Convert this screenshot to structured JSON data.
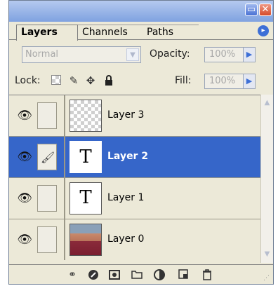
{
  "tabs": [
    {
      "label": "Layers",
      "active": true
    },
    {
      "label": "Channels",
      "active": false
    },
    {
      "label": "Paths",
      "active": false
    }
  ],
  "blend_mode": {
    "value": "Normal"
  },
  "opacity": {
    "label": "Opacity:",
    "value": "100%"
  },
  "lock": {
    "label": "Lock:"
  },
  "fill": {
    "label": "Fill:",
    "value": "100%"
  },
  "layers": [
    {
      "name": "Layer 3",
      "thumb": "transparent",
      "selected": false,
      "visible": true,
      "brush": false
    },
    {
      "name": "Layer 2",
      "thumb": "text",
      "selected": true,
      "visible": true,
      "brush": true
    },
    {
      "name": "Layer 1",
      "thumb": "text",
      "selected": false,
      "visible": true,
      "brush": false
    },
    {
      "name": "Layer 0",
      "thumb": "photo",
      "selected": false,
      "visible": true,
      "brush": false
    }
  ],
  "thumb_glyph": "T",
  "icons": {
    "minimize": "minimize-icon",
    "close": "close-icon",
    "panel_menu": "panel-menu-icon",
    "eye": "eye-icon",
    "brush": "brush-icon",
    "lock_transparent": "lock-transparent-icon",
    "lock_image": "lock-image-icon",
    "lock_position": "move-icon",
    "lock_all": "lock-icon",
    "bottom": [
      "link-layers-icon",
      "layer-style-icon",
      "layer-mask-icon",
      "new-group-icon",
      "adjustment-layer-icon",
      "new-layer-icon",
      "trash-icon"
    ]
  },
  "colors": {
    "selection": "#3666c9",
    "panel_bg": "#ece9d8",
    "accent": "#3d6fd6"
  }
}
